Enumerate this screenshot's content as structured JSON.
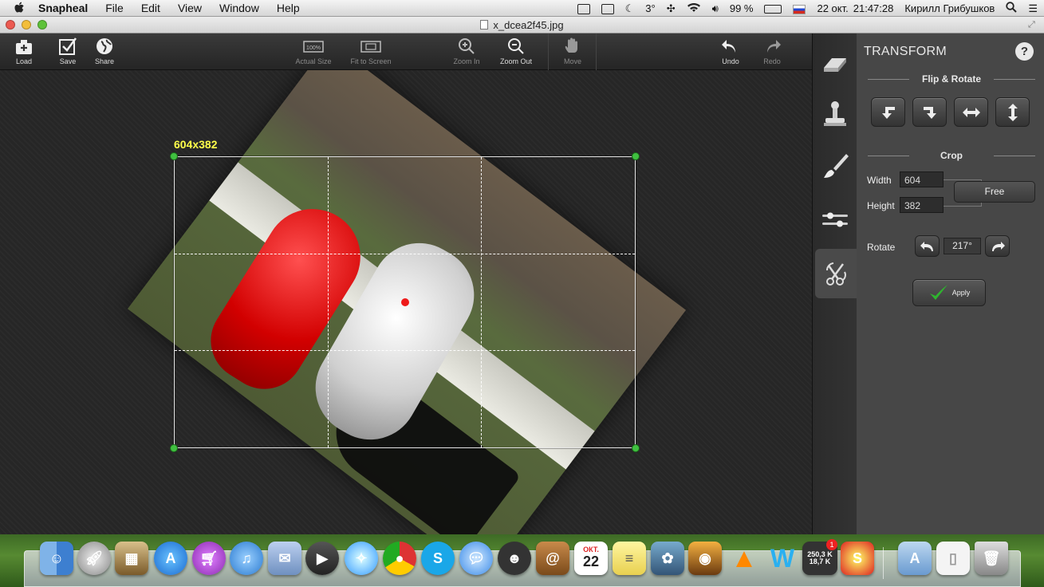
{
  "menubar": {
    "app_name": "Snapheal",
    "menus": [
      "File",
      "Edit",
      "View",
      "Window",
      "Help"
    ],
    "temperature": "3°",
    "battery": "99 %",
    "date": "22 окт.",
    "time": "21:47:28",
    "user": "Кирилл Грибушков"
  },
  "window": {
    "title": "x_dcea2f45.jpg"
  },
  "toolbar": {
    "load": "Load",
    "save": "Save",
    "share": "Share",
    "actual_size": "Actual Size",
    "fit_to_screen": "Fit to Screen",
    "zoom_in": "Zoom In",
    "zoom_out": "Zoom Out",
    "move": "Move",
    "undo": "Undo",
    "redo": "Redo"
  },
  "canvas": {
    "crop_dimensions": "604x382"
  },
  "sidebar": {
    "tools": [
      "eraser-icon",
      "stamp-icon",
      "brush-icon",
      "sliders-icon",
      "transform-icon"
    ],
    "active_tool": "transform-icon"
  },
  "panel": {
    "title": "TRANSFORM",
    "help": "?",
    "flip_rotate_heading": "Flip & Rotate",
    "crop_heading": "Crop",
    "width_label": "Width",
    "width_value": "604",
    "height_label": "Height",
    "height_value": "382",
    "aspect_button": "Free",
    "rotate_label": "Rotate",
    "rotate_value": "217°",
    "apply": "Apply"
  },
  "dock": {
    "tracker_top": "250,3 K",
    "tracker_bottom": "18,7 K",
    "calendar_month": "ОКТ.",
    "calendar_day": "22",
    "badge": "1"
  },
  "colors": {
    "dimension_label": "#ffff4a",
    "handle": "#40c040",
    "center_dot": "#ee1a1a",
    "apply_check": "#2fb52f"
  }
}
